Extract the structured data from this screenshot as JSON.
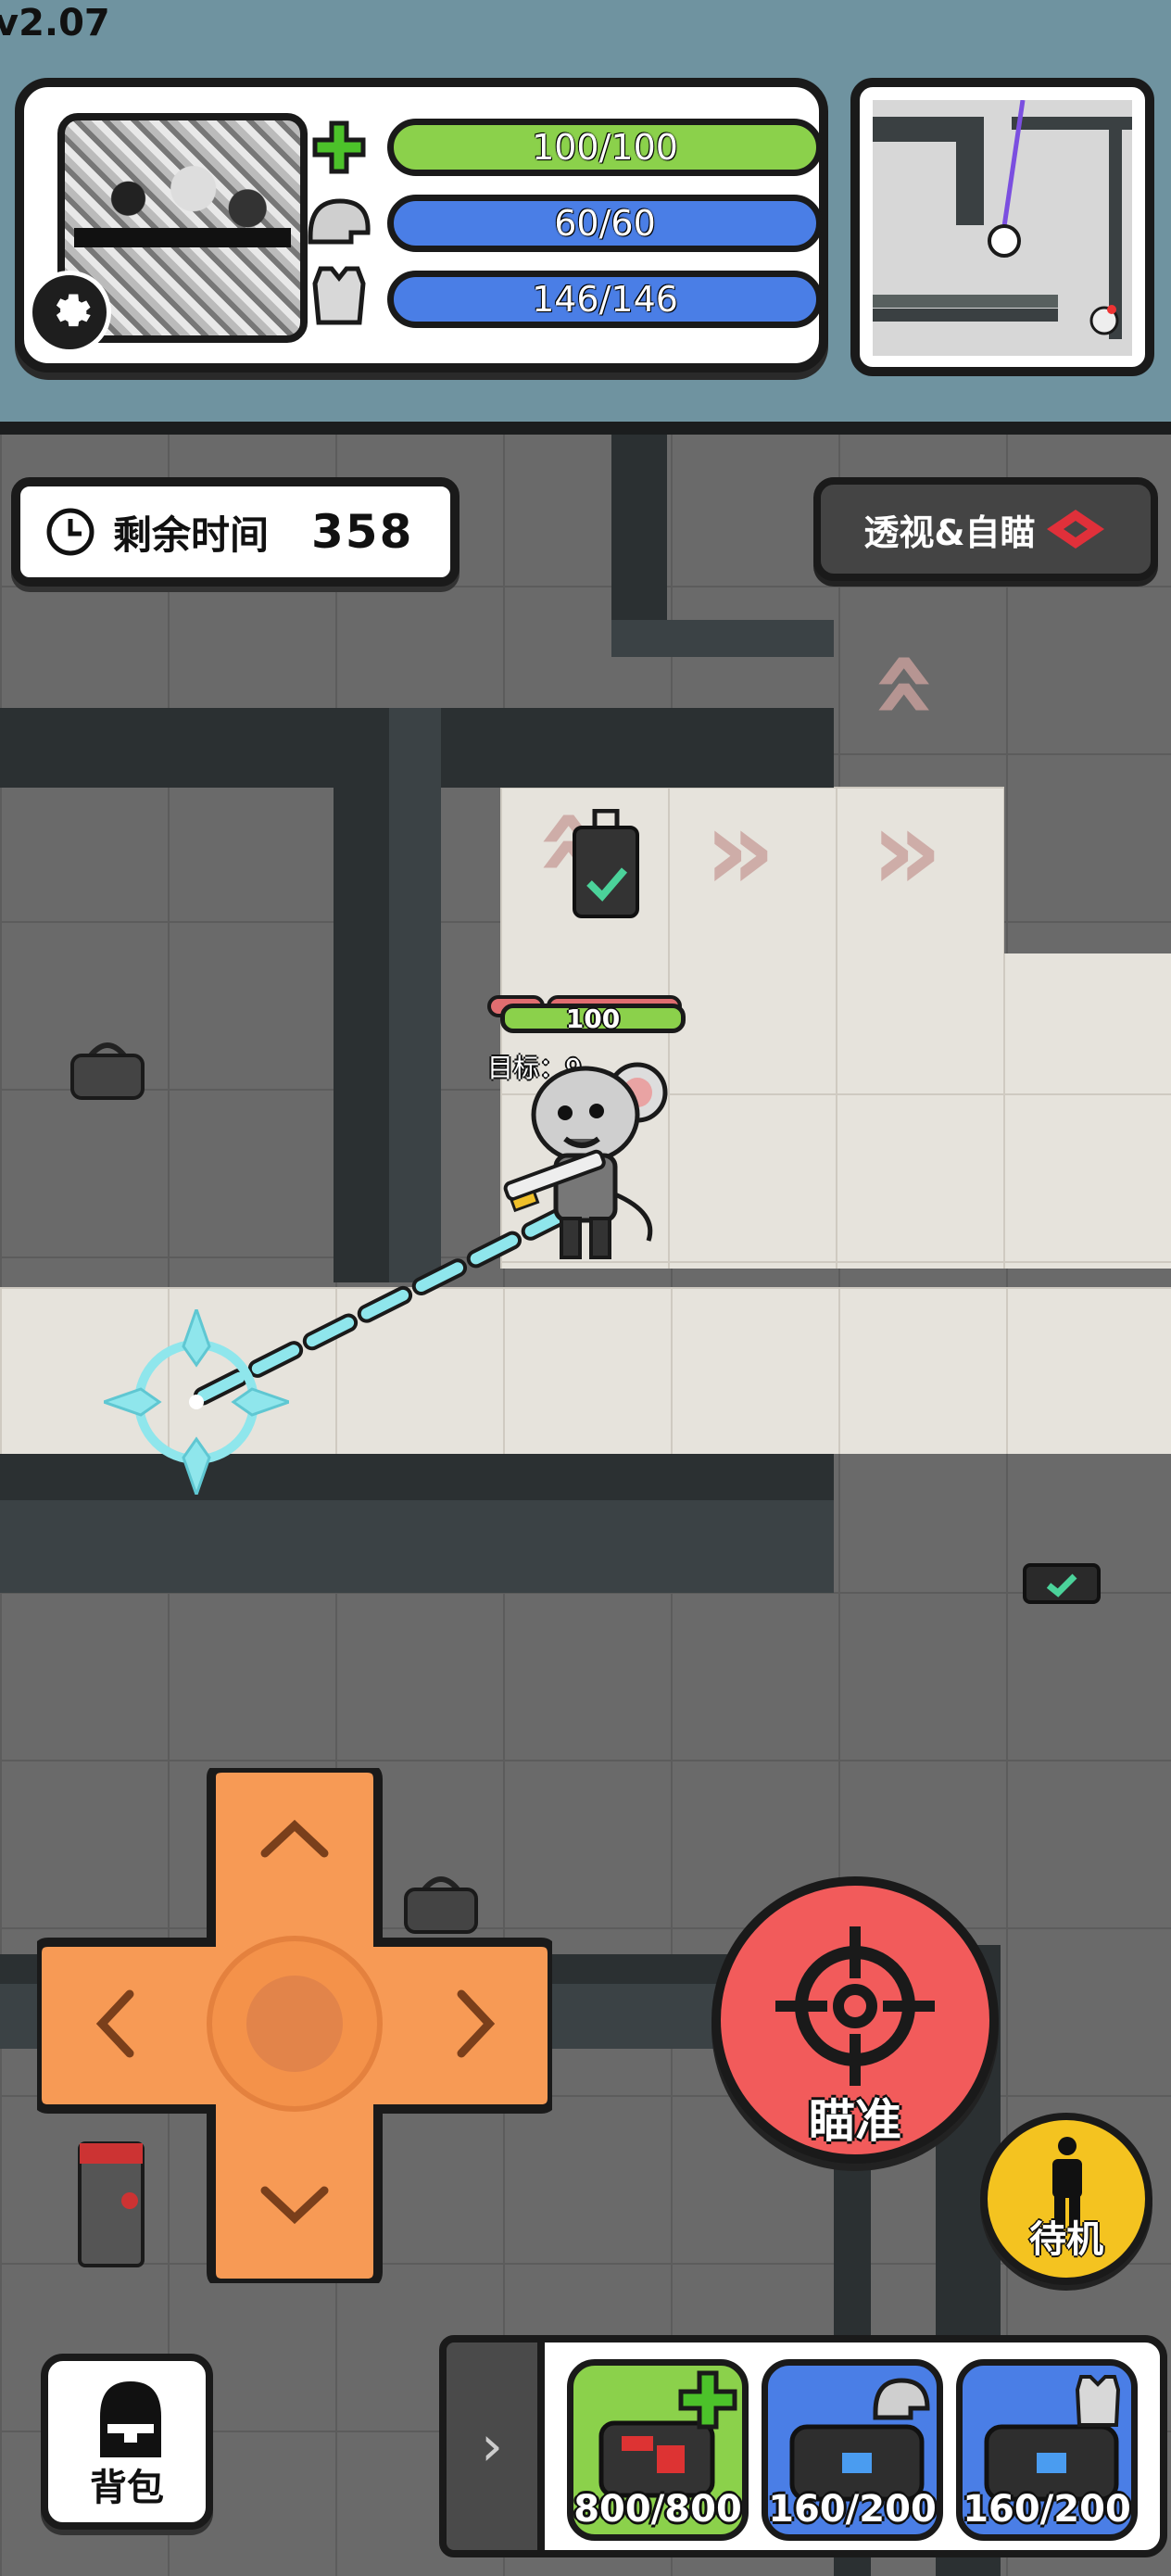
{
  "version": "v2.07",
  "status": {
    "hp": "100/100",
    "helmet": "60/60",
    "armor": "146/146",
    "icons": [
      "health-cross-icon",
      "helmet-icon",
      "armor-vest-icon"
    ]
  },
  "timer": {
    "label": "剩余时间",
    "value": "358"
  },
  "xray_button": {
    "label": "透视&自瞄"
  },
  "player": {
    "hp": "100",
    "target_label": "目标：9"
  },
  "controls": {
    "fire_label": "瞄准",
    "idle_label": "待机",
    "backpack_label": "背包"
  },
  "items": [
    {
      "name": "medkit",
      "value": "800/800",
      "color": "#8bd14b"
    },
    {
      "name": "helmet-repair",
      "value": "160/200",
      "color": "#4a7ee6"
    },
    {
      "name": "armor-repair",
      "value": "160/200",
      "color": "#4a7ee6"
    }
  ],
  "colors": {
    "accent_red": "#f25b5b",
    "accent_orange": "#f79a55",
    "accent_yellow": "#f4c320",
    "hp_green": "#8bd14b",
    "shield_blue": "#4a7ee6"
  }
}
